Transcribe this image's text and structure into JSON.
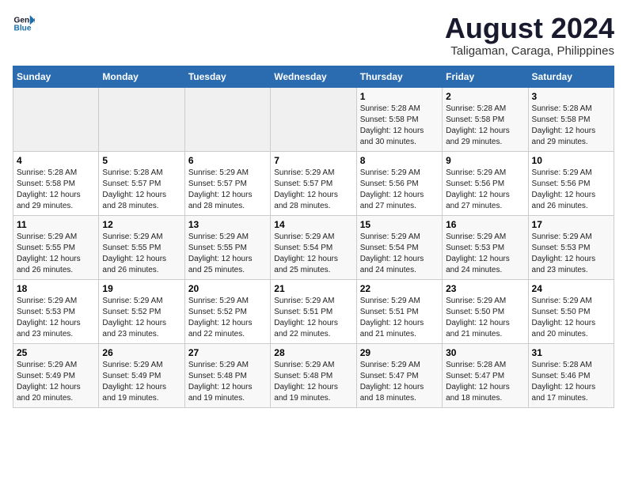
{
  "logo": {
    "line1": "General",
    "line2": "Blue"
  },
  "title": "August 2024",
  "subtitle": "Taligaman, Caraga, Philippines",
  "days_of_week": [
    "Sunday",
    "Monday",
    "Tuesday",
    "Wednesday",
    "Thursday",
    "Friday",
    "Saturday"
  ],
  "weeks": [
    [
      {
        "day": "",
        "info": ""
      },
      {
        "day": "",
        "info": ""
      },
      {
        "day": "",
        "info": ""
      },
      {
        "day": "",
        "info": ""
      },
      {
        "day": "1",
        "info": "Sunrise: 5:28 AM\nSunset: 5:58 PM\nDaylight: 12 hours\nand 30 minutes."
      },
      {
        "day": "2",
        "info": "Sunrise: 5:28 AM\nSunset: 5:58 PM\nDaylight: 12 hours\nand 29 minutes."
      },
      {
        "day": "3",
        "info": "Sunrise: 5:28 AM\nSunset: 5:58 PM\nDaylight: 12 hours\nand 29 minutes."
      }
    ],
    [
      {
        "day": "4",
        "info": "Sunrise: 5:28 AM\nSunset: 5:58 PM\nDaylight: 12 hours\nand 29 minutes."
      },
      {
        "day": "5",
        "info": "Sunrise: 5:28 AM\nSunset: 5:57 PM\nDaylight: 12 hours\nand 28 minutes."
      },
      {
        "day": "6",
        "info": "Sunrise: 5:29 AM\nSunset: 5:57 PM\nDaylight: 12 hours\nand 28 minutes."
      },
      {
        "day": "7",
        "info": "Sunrise: 5:29 AM\nSunset: 5:57 PM\nDaylight: 12 hours\nand 28 minutes."
      },
      {
        "day": "8",
        "info": "Sunrise: 5:29 AM\nSunset: 5:56 PM\nDaylight: 12 hours\nand 27 minutes."
      },
      {
        "day": "9",
        "info": "Sunrise: 5:29 AM\nSunset: 5:56 PM\nDaylight: 12 hours\nand 27 minutes."
      },
      {
        "day": "10",
        "info": "Sunrise: 5:29 AM\nSunset: 5:56 PM\nDaylight: 12 hours\nand 26 minutes."
      }
    ],
    [
      {
        "day": "11",
        "info": "Sunrise: 5:29 AM\nSunset: 5:55 PM\nDaylight: 12 hours\nand 26 minutes."
      },
      {
        "day": "12",
        "info": "Sunrise: 5:29 AM\nSunset: 5:55 PM\nDaylight: 12 hours\nand 26 minutes."
      },
      {
        "day": "13",
        "info": "Sunrise: 5:29 AM\nSunset: 5:55 PM\nDaylight: 12 hours\nand 25 minutes."
      },
      {
        "day": "14",
        "info": "Sunrise: 5:29 AM\nSunset: 5:54 PM\nDaylight: 12 hours\nand 25 minutes."
      },
      {
        "day": "15",
        "info": "Sunrise: 5:29 AM\nSunset: 5:54 PM\nDaylight: 12 hours\nand 24 minutes."
      },
      {
        "day": "16",
        "info": "Sunrise: 5:29 AM\nSunset: 5:53 PM\nDaylight: 12 hours\nand 24 minutes."
      },
      {
        "day": "17",
        "info": "Sunrise: 5:29 AM\nSunset: 5:53 PM\nDaylight: 12 hours\nand 23 minutes."
      }
    ],
    [
      {
        "day": "18",
        "info": "Sunrise: 5:29 AM\nSunset: 5:53 PM\nDaylight: 12 hours\nand 23 minutes."
      },
      {
        "day": "19",
        "info": "Sunrise: 5:29 AM\nSunset: 5:52 PM\nDaylight: 12 hours\nand 23 minutes."
      },
      {
        "day": "20",
        "info": "Sunrise: 5:29 AM\nSunset: 5:52 PM\nDaylight: 12 hours\nand 22 minutes."
      },
      {
        "day": "21",
        "info": "Sunrise: 5:29 AM\nSunset: 5:51 PM\nDaylight: 12 hours\nand 22 minutes."
      },
      {
        "day": "22",
        "info": "Sunrise: 5:29 AM\nSunset: 5:51 PM\nDaylight: 12 hours\nand 21 minutes."
      },
      {
        "day": "23",
        "info": "Sunrise: 5:29 AM\nSunset: 5:50 PM\nDaylight: 12 hours\nand 21 minutes."
      },
      {
        "day": "24",
        "info": "Sunrise: 5:29 AM\nSunset: 5:50 PM\nDaylight: 12 hours\nand 20 minutes."
      }
    ],
    [
      {
        "day": "25",
        "info": "Sunrise: 5:29 AM\nSunset: 5:49 PM\nDaylight: 12 hours\nand 20 minutes."
      },
      {
        "day": "26",
        "info": "Sunrise: 5:29 AM\nSunset: 5:49 PM\nDaylight: 12 hours\nand 19 minutes."
      },
      {
        "day": "27",
        "info": "Sunrise: 5:29 AM\nSunset: 5:48 PM\nDaylight: 12 hours\nand 19 minutes."
      },
      {
        "day": "28",
        "info": "Sunrise: 5:29 AM\nSunset: 5:48 PM\nDaylight: 12 hours\nand 19 minutes."
      },
      {
        "day": "29",
        "info": "Sunrise: 5:29 AM\nSunset: 5:47 PM\nDaylight: 12 hours\nand 18 minutes."
      },
      {
        "day": "30",
        "info": "Sunrise: 5:28 AM\nSunset: 5:47 PM\nDaylight: 12 hours\nand 18 minutes."
      },
      {
        "day": "31",
        "info": "Sunrise: 5:28 AM\nSunset: 5:46 PM\nDaylight: 12 hours\nand 17 minutes."
      }
    ]
  ]
}
